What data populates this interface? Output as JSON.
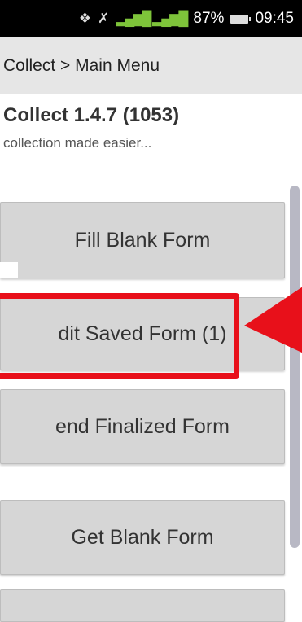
{
  "status_bar": {
    "battery_percent": "87%",
    "time": "09:45",
    "icons": [
      "bluetooth-icon",
      "mute-icon",
      "signal-icon",
      "battery-icon"
    ]
  },
  "action_bar": {
    "breadcrumb": "Collect > Main Menu"
  },
  "header": {
    "title": "Collect 1.4.7 (1053)",
    "subtitle": "collection made easier..."
  },
  "menu": {
    "fill_blank_form": "Fill Blank Form",
    "edit_saved_form": "dit Saved Form (1)",
    "send_finalized_form": "end Finalized Form",
    "get_blank_form": "Get Blank Form"
  },
  "colors": {
    "highlight": "#e8101a",
    "button_bg": "#d6d6d6",
    "action_bar_bg": "#e6e6e6"
  }
}
